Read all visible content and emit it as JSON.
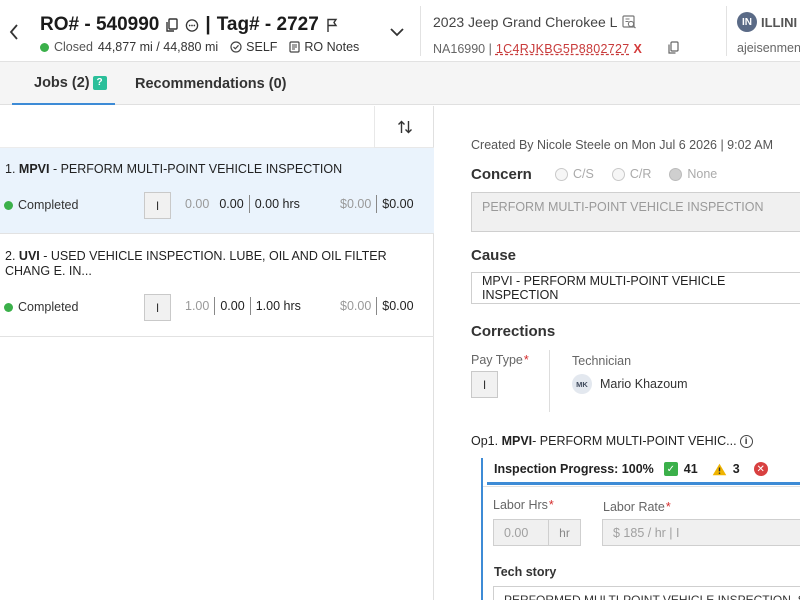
{
  "header": {
    "ro_label": "RO# - 540990",
    "separator": "|",
    "tag_label": "Tag# - 2727",
    "status": "Closed",
    "status_color": "#3bb04a",
    "mileage": "44,877 mi / 44,880 mi",
    "pay": "SELF",
    "notes": "RO Notes",
    "vehicle": "2023 Jeep Grand Cherokee L",
    "stock": "NA16990 |",
    "vin": "1C4RJKBG5P8802727",
    "vin_flag": "X",
    "dealer_badge": "IN",
    "dealer": "ILLINI",
    "user": "ajeisenmen"
  },
  "tabs": [
    {
      "label": "Jobs (2)",
      "badge": "?"
    },
    {
      "label": "Recommendations (0)"
    }
  ],
  "jobs": [
    {
      "num": "1.",
      "code": "MPVI",
      "desc": " - PERFORM MULTI-POINT VEHICLE INSPECTION",
      "status": "Completed",
      "pay_type": "I",
      "v1": "0.00",
      "v2": "0.00",
      "hrs": "0.00 hrs",
      "amt1": "$0.00",
      "amt2": "$0.00"
    },
    {
      "num": "2.",
      "code": "UVI",
      "desc": " - USED VEHICLE INSPECTION. LUBE, OIL AND OIL FILTER CHANG E. IN...",
      "status": "Completed",
      "pay_type": "I",
      "v1": "1.00",
      "v2": "0.00",
      "hrs": "1.00 hrs",
      "amt1": "$0.00",
      "amt2": "$0.00"
    }
  ],
  "detail": {
    "created": "Created By Nicole Steele on Mon Jul 6 2026 | 9:02 AM",
    "concern_title": "Concern",
    "concern_options": [
      "C/S",
      "C/R",
      "None"
    ],
    "concern_text": "PERFORM MULTI-POINT VEHICLE INSPECTION",
    "cause_title": "Cause",
    "cause_text": "MPVI - PERFORM MULTI-POINT VEHICLE INSPECTION",
    "corrections_title": "Corrections",
    "pay_type_label": "Pay Type",
    "pay_type_value": "I",
    "technician_label": "Technician",
    "tech_initials": "MK",
    "tech_name": "Mario Khazoum",
    "op_prefix": "Op1.",
    "op_code": "MPVI",
    "op_desc": " - PERFORM MULTI-POINT VEHIC...",
    "inspection_label": "Inspection Progress: 100%",
    "progress": 1.0,
    "count_ok": "41",
    "count_warn": "3",
    "labor_hrs_label": "Labor Hrs",
    "labor_hrs_value": "0.00",
    "labor_hrs_unit": "hr",
    "labor_rate_label": "Labor Rate",
    "labor_rate_value": "$ 185 / hr | I",
    "tech_story_label": "Tech story",
    "tech_story_value": "PERFORMED MULTI-POINT VEHICLE INSPECTION. S"
  },
  "colors": {
    "accent": "#3d8bd6",
    "green": "#3bb04a",
    "warning": "#f0b400",
    "error": "#d84040",
    "vin": "#c83a3a"
  }
}
